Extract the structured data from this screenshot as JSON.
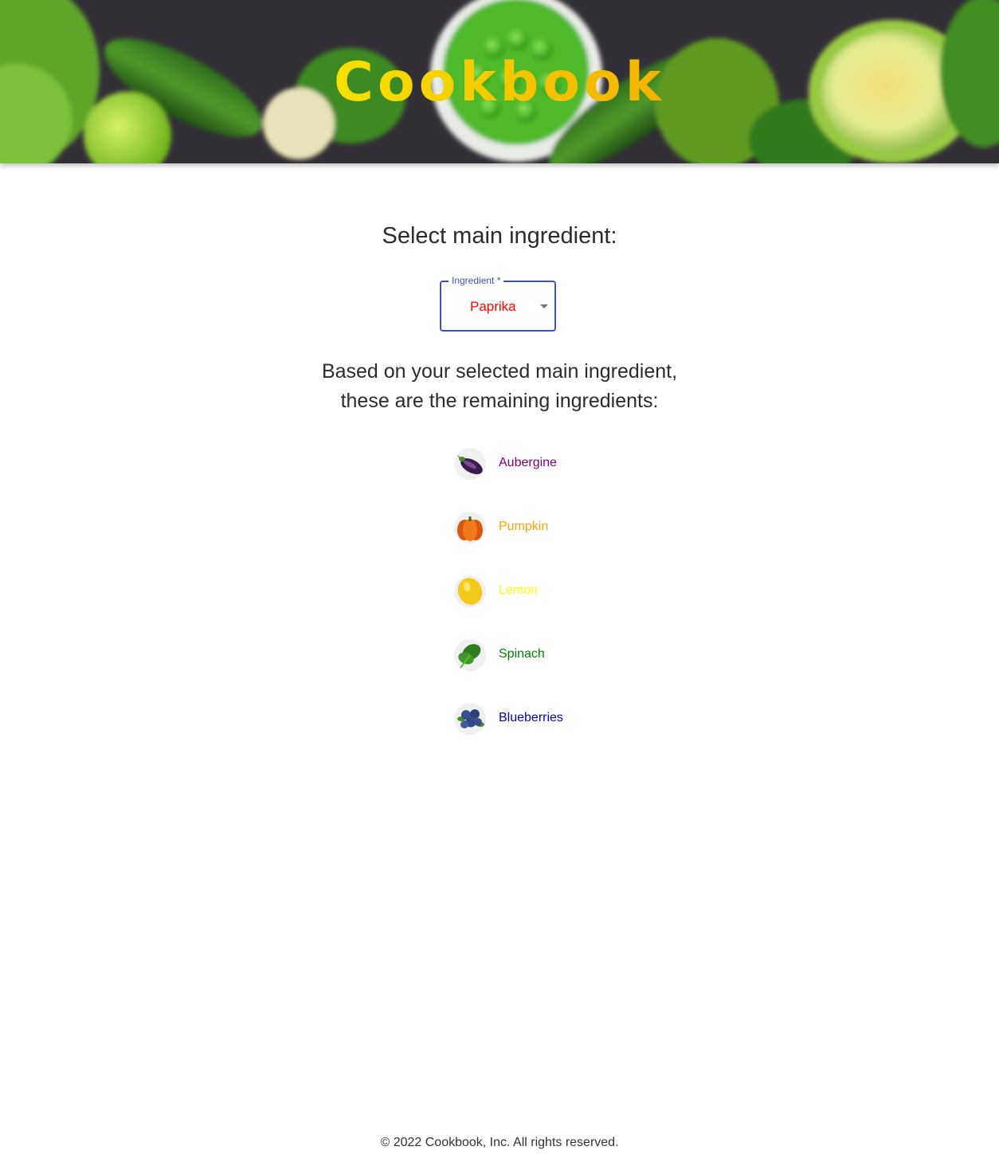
{
  "header": {
    "title": "Cookbook",
    "background_image": "green-vegetables-banner"
  },
  "select_section": {
    "heading": "Select main ingredient:",
    "field": {
      "label": "Ingredient *",
      "selected_value": "Paprika",
      "selected_color": "#ff0000",
      "accent_color": "#3f51b5",
      "icon": "chevron-down-icon"
    }
  },
  "results": {
    "heading_line1": "Based on your selected main ingredient,",
    "heading_line2": "these are the remaining ingredients:",
    "ingredients": [
      {
        "name": "Aubergine",
        "color": "#800080",
        "icon": "aubergine-icon"
      },
      {
        "name": "Pumpkin",
        "color": "#ffa500",
        "icon": "pumpkin-icon"
      },
      {
        "name": "Lemon",
        "color": "#ffff00",
        "icon": "lemon-icon"
      },
      {
        "name": "Spinach",
        "color": "#008000",
        "icon": "spinach-icon"
      },
      {
        "name": "Blueberries",
        "color": "#0000cd",
        "icon": "blueberries-icon"
      }
    ]
  },
  "footer": {
    "copyright": "© 2022 Cookbook, Inc. All rights reserved."
  }
}
